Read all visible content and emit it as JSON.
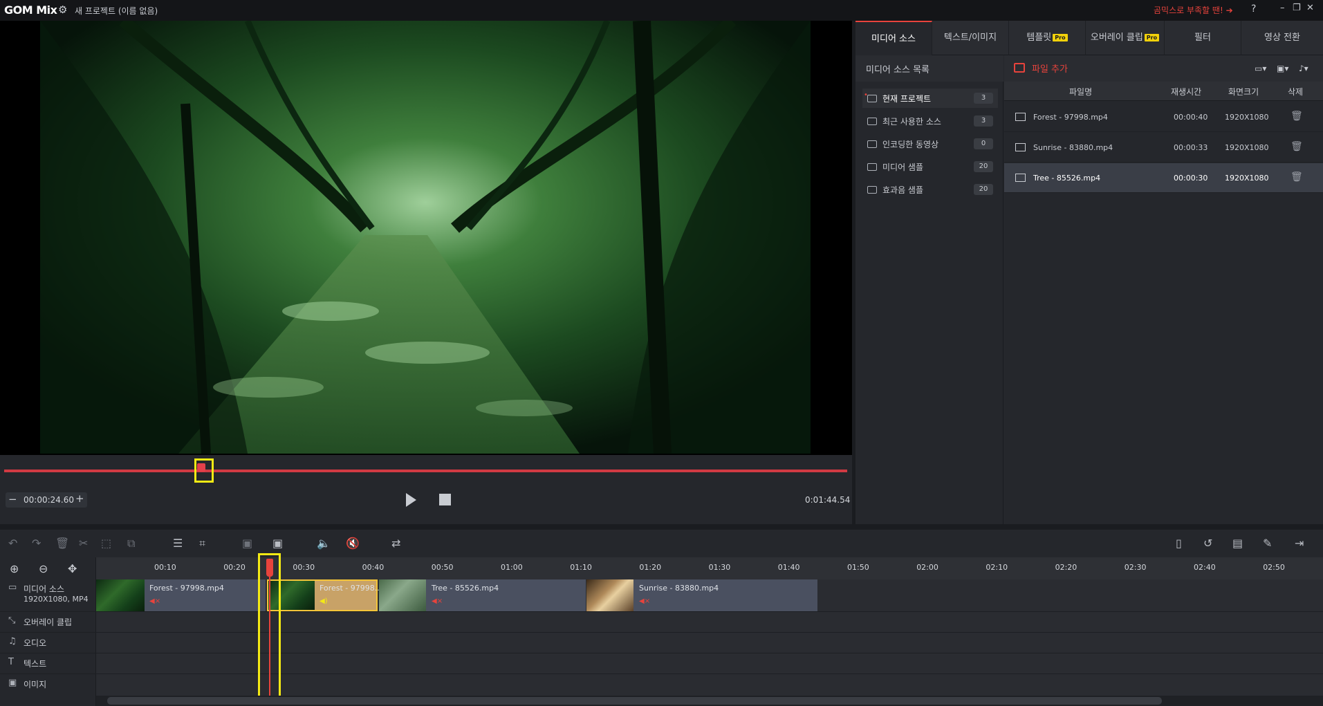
{
  "app": {
    "logo": "GOM Mix",
    "project_title": "새 프로젝트 (이름 없음)",
    "promo_text": "곰믹스로 부족할 땐! ➔",
    "help": "?",
    "minimize": "–",
    "restore": "❐",
    "close": "✕"
  },
  "player": {
    "current_time": "00:00:24.60",
    "total_time": "0:01:44.54",
    "minus": "−",
    "plus": "+"
  },
  "tabs": [
    {
      "label": "미디어 소스",
      "pro": ""
    },
    {
      "label": "텍스트/이미지",
      "pro": ""
    },
    {
      "label": "템플릿",
      "pro": "Pro"
    },
    {
      "label": "오버레이 클립",
      "pro": "Pro"
    },
    {
      "label": "필터",
      "pro": ""
    },
    {
      "label": "영상 전환",
      "pro": ""
    }
  ],
  "sources": {
    "header": "미디어 소스 목록",
    "items": [
      {
        "label": "현재 프로젝트",
        "count": "3"
      },
      {
        "label": "최근 사용한 소스",
        "count": "3"
      },
      {
        "label": "인코딩한 동영상",
        "count": "0"
      },
      {
        "label": "미디어 샘플",
        "count": "20"
      },
      {
        "label": "효과음 샘플",
        "count": "20"
      }
    ]
  },
  "files": {
    "add_label": "파일 추가",
    "columns": [
      "파일명",
      "재생시간",
      "화면크기",
      "삭제"
    ],
    "rows": [
      {
        "name": "Forest - 97998.mp4",
        "duration": "00:00:40",
        "size": "1920X1080"
      },
      {
        "name": "Sunrise - 83880.mp4",
        "duration": "00:00:33",
        "size": "1920X1080"
      },
      {
        "name": "Tree - 85526.mp4",
        "duration": "00:00:30",
        "size": "1920X1080"
      }
    ]
  },
  "timeline": {
    "ticks": [
      "00:10",
      "00:20",
      "00:30",
      "00:40",
      "00:50",
      "01:00",
      "01:10",
      "01:20",
      "01:30",
      "01:40",
      "01:50",
      "02:00",
      "02:10",
      "02:20",
      "02:30",
      "02:40",
      "02:50"
    ],
    "tracks": [
      {
        "label": "미디어 소스",
        "sub": "1920X1080, MP4"
      },
      {
        "label": "오버레이 클립",
        "sub": ""
      },
      {
        "label": "오디오",
        "sub": ""
      },
      {
        "label": "텍스트",
        "sub": ""
      },
      {
        "label": "이미지",
        "sub": ""
      }
    ],
    "clips": [
      {
        "name": "Forest - 97998.mp4"
      },
      {
        "name": "Forest - 97998..."
      },
      {
        "name": "Tree - 85526.mp4"
      },
      {
        "name": "Sunrise - 83880.mp4"
      }
    ]
  },
  "colors": {
    "accent": "#e8433c",
    "highlight": "#f4ea14",
    "selected_clip": "#c8a267",
    "panel_bg": "#25272c"
  }
}
